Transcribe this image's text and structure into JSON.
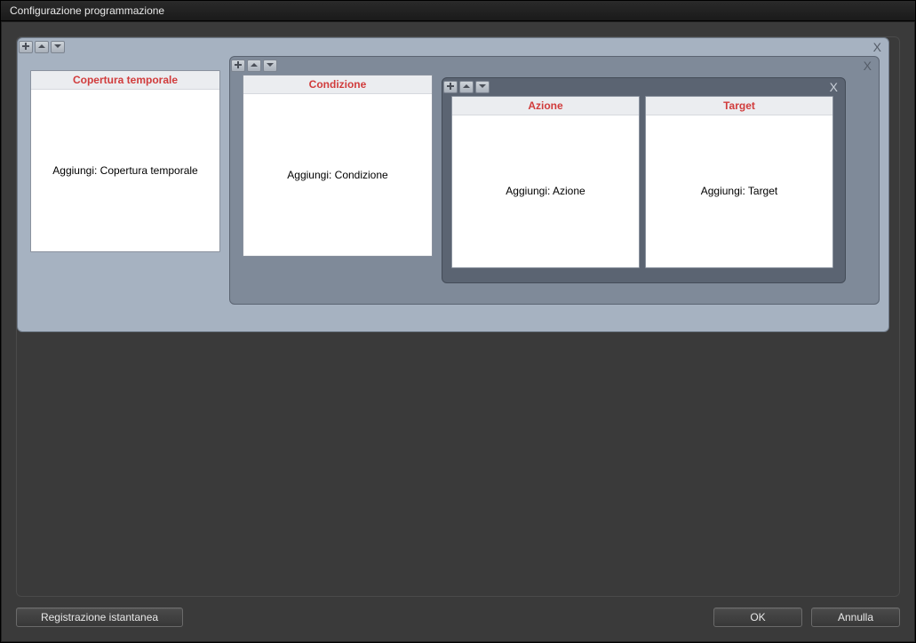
{
  "window": {
    "title": "Configurazione programmazione"
  },
  "panels": {
    "outer_close": "X",
    "mid_close": "X",
    "inner_close": "X"
  },
  "cards": {
    "temporal": {
      "header": "Copertura temporale",
      "body": "Aggiungi: Copertura temporale"
    },
    "condition": {
      "header": "Condizione",
      "body": "Aggiungi: Condizione"
    },
    "action": {
      "header": "Azione",
      "body": "Aggiungi: Azione"
    },
    "target": {
      "header": "Target",
      "body": "Aggiungi: Target"
    }
  },
  "footer": {
    "instant": "Registrazione istantanea",
    "ok": "OK",
    "cancel": "Annulla"
  }
}
